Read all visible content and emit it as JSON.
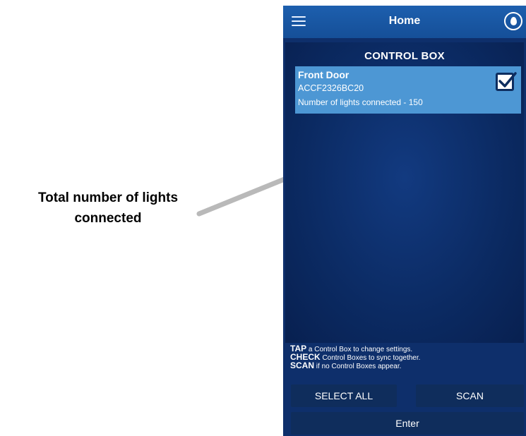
{
  "annotation": {
    "line1": "Total number of lights",
    "line2": "connected"
  },
  "header": {
    "title": "Home",
    "menu_icon": "hamburger-menu-icon",
    "right_icon": "drop-icon"
  },
  "section": {
    "title": "CONTROL BOX"
  },
  "control_boxes": [
    {
      "name": "Front Door",
      "id": "ACCF2326BC20",
      "lights": "Number of lights connected - 150",
      "checked": true
    }
  ],
  "instructions": [
    {
      "keyword": "TAP",
      "text": "a Control Box to change settings."
    },
    {
      "keyword": "CHECK",
      "text": "Control Boxes to sync together."
    },
    {
      "keyword": "SCAN",
      "text": "if no Control Boxes appear."
    }
  ],
  "buttons": {
    "select_all": "SELECT ALL",
    "scan": "SCAN",
    "enter": "Enter"
  },
  "colors": {
    "header": "#1d5fae",
    "background": "#0e2f6b",
    "card": "#4d97d4",
    "button": "#0f2d5c"
  }
}
